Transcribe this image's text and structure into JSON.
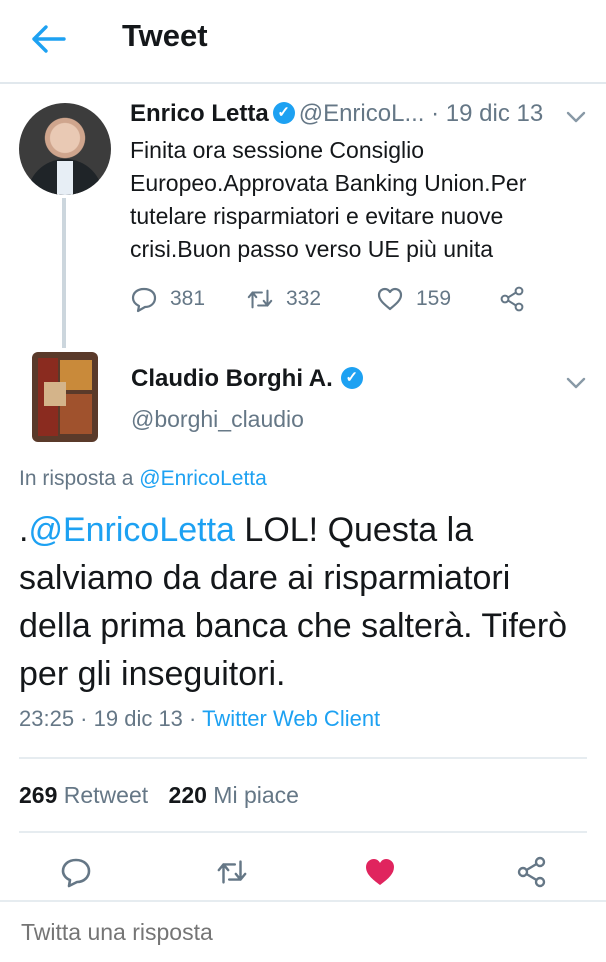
{
  "header": {
    "title": "Tweet",
    "back_icon": "arrow-left-icon"
  },
  "colors": {
    "accent": "#1da1f2",
    "muted": "#657786",
    "like": "#e0245e"
  },
  "parent_tweet": {
    "name": "Enrico Letta",
    "handle": "@EnricoL...",
    "separator": "·",
    "date": "19 dic 13",
    "text": "Finita ora sessione Consiglio Europeo.Approvata Banking Union.Per tutelare risparmiatori e evitare nuove crisi.Buon passo verso UE più unita",
    "replies": "381",
    "retweets": "332",
    "likes": "159"
  },
  "tweet": {
    "name": "Claudio Borghi A.",
    "handle": "@borghi_claudio",
    "replying_prefix": "In risposta a",
    "replying_to": "@EnricoLetta",
    "text_prefix": ".",
    "text_mention": "@EnricoLetta",
    "text_body": " LOL! Questa la salviamo da dare ai risparmiatori della prima banca che salterà. Tiferò per gli inseguitori.",
    "time": "23:25",
    "date": "19 dic 13",
    "meta_sep": " · ",
    "client": "Twitter Web Client",
    "retweet_count": "269",
    "retweet_label": "Retweet",
    "like_count": "220",
    "like_label": "Mi piace"
  },
  "reply_box": {
    "placeholder": "Twitta una risposta"
  }
}
